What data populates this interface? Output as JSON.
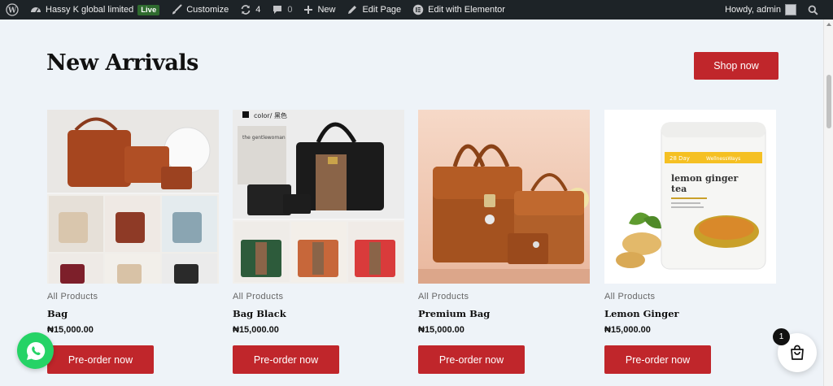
{
  "adminbar": {
    "site_name": "Hassy K global limited",
    "live_badge": "Live",
    "customize": "Customize",
    "updates_count": "4",
    "comments_count": "0",
    "new": "New",
    "edit_page": "Edit Page",
    "edit_elementor": "Edit with Elementor",
    "howdy": "Howdy, admin",
    "icons": [
      "wordpress-logo-icon",
      "dashboard-icon",
      "brush-icon",
      "refresh-icon",
      "comment-icon",
      "plus-icon",
      "pencil-icon",
      "elementor-icon",
      "search-icon"
    ]
  },
  "section": {
    "title": "New Arrivals",
    "shop_button": "Shop now"
  },
  "products": [
    {
      "category": "All Products",
      "name": "Bag",
      "price": "₦15,000.00",
      "button": "Pre-order now"
    },
    {
      "category": "All Products",
      "name": "Bag Black",
      "price": "₦15,000.00",
      "button": "Pre-order now"
    },
    {
      "category": "All Products",
      "name": "Premium Bag",
      "price": "₦15,000.00",
      "button": "Pre-order now"
    },
    {
      "category": "All Products",
      "name": "Lemon Ginger",
      "price": "₦15,000.00",
      "button": "Pre-order now"
    }
  ],
  "product_image_text": {
    "p2_label": "color/ 黑色",
    "p2_mag": "the gentlewoman",
    "p4_day": "28 Day",
    "p4_brand": "WellnessWays",
    "p4_line1": "lemon ginger",
    "p4_line2": "tea"
  },
  "cart": {
    "count": "1"
  },
  "colors": {
    "brand_red": "#c0262b",
    "adminbar": "#1d2327",
    "page_bg": "#eef3f8",
    "whatsapp": "#25d366"
  }
}
